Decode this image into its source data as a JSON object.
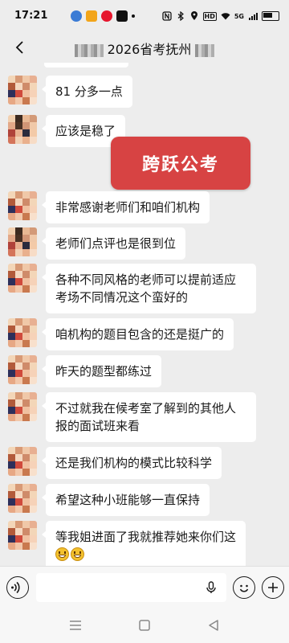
{
  "status": {
    "time": "17:21",
    "network_label": "5G",
    "hd_label": "HD"
  },
  "header": {
    "title": "2026省考抚州"
  },
  "watermark": "跨跃公考",
  "messages": [
    {
      "text": "81 分多一点"
    },
    {
      "text": "应该是稳了"
    },
    {
      "text": "非常感谢老师们和咱们机构"
    },
    {
      "text": "老师们点评也是很到位"
    },
    {
      "text": "各种不同风格的老师可以提前适应考场不同情况这个蛮好的"
    },
    {
      "text": "咱机构的题目包含的还是挺广的"
    },
    {
      "text": "昨天的题型都练过"
    },
    {
      "text": "不过就我在候考室了解到的其他人报的面试班来看"
    },
    {
      "text": "还是我们机构的模式比较科学"
    },
    {
      "text": "希望这种小班能够一直保持"
    },
    {
      "text": "等我姐进面了我就推荐她来你们这"
    }
  ],
  "emoji_icons": [
    "grinning-face-icon",
    "grinning-face-icon"
  ],
  "colors": {
    "background": "#ededed",
    "bubble": "#ffffff",
    "watermark": "#d74343"
  }
}
